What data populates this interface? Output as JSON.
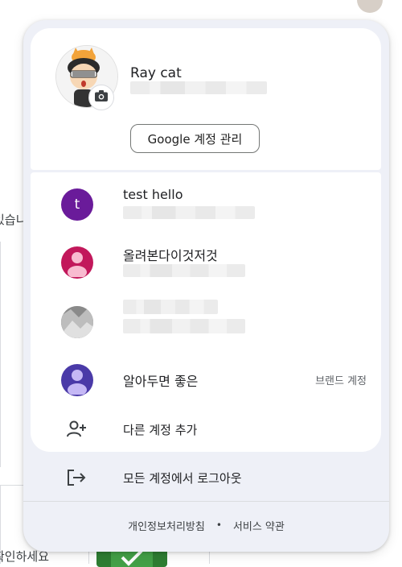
{
  "background": {
    "fragment_1": "있습니",
    "fragment_2": "확인하세요"
  },
  "account_menu": {
    "current_account": {
      "name": "Ray cat",
      "manage_button": "Google 계정 관리"
    },
    "accounts": [
      {
        "name": "test hello",
        "avatar_letter": "t",
        "avatar_color": "#6a1b9a"
      },
      {
        "name": "올려본다이것저것",
        "avatar_color": "#c2185b"
      },
      {
        "name": "",
        "avatar_color": "#9e9e9e"
      },
      {
        "name": "알아두면 좋은",
        "tag": "브랜드 계정",
        "avatar_color": "#4a3aa8"
      }
    ],
    "add_account": "다른 계정 추가",
    "sign_out_all": "모든 계정에서 로그아웃",
    "footer": {
      "privacy": "개인정보처리방침",
      "separator": "•",
      "terms": "서비스 약관"
    }
  },
  "icons": [
    "camera-icon",
    "add-person-icon",
    "logout-icon",
    "person-icon",
    "checkmark-icon"
  ]
}
